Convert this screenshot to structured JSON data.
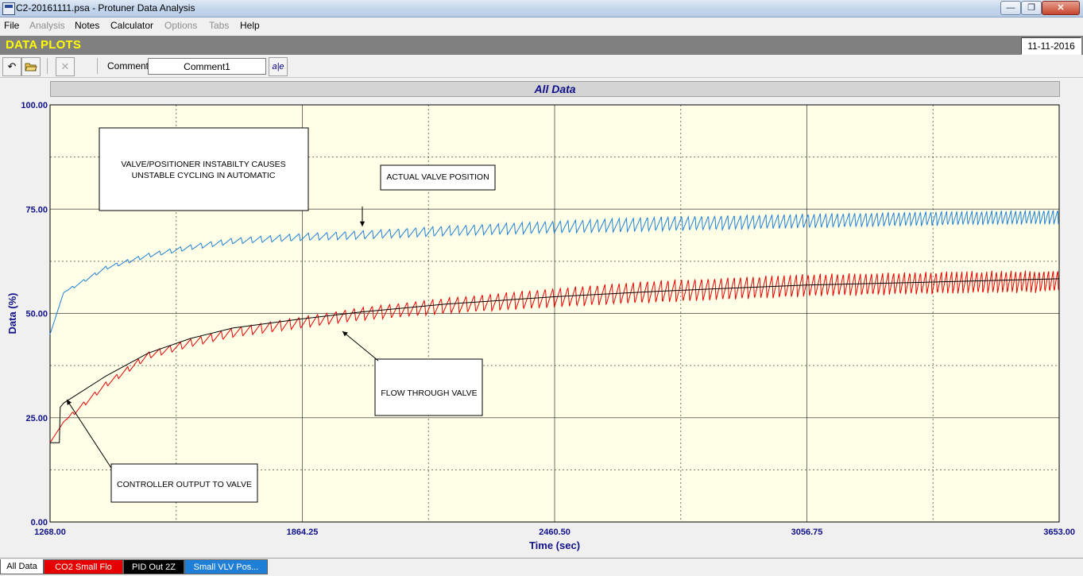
{
  "window": {
    "title": "C2-20161111.psa - Protuner Data  Analysis",
    "controls": {
      "minimize": "—",
      "maximize": "❐",
      "close": "✕"
    }
  },
  "menu": [
    {
      "label": "File",
      "enabled": true
    },
    {
      "label": "Analysis",
      "enabled": false
    },
    {
      "label": "Notes",
      "enabled": true
    },
    {
      "label": "Calculator",
      "enabled": true
    },
    {
      "label": "Options",
      "enabled": false
    },
    {
      "label": "Tabs",
      "enabled": false
    },
    {
      "label": "Help",
      "enabled": true
    }
  ],
  "banner": {
    "title": "DATA PLOTS",
    "date": "11-11-2016"
  },
  "toolbar": {
    "undo_icon": "undo-icon",
    "open_icon": "folder-open-icon",
    "delete_icon": "close-x-icon",
    "comment_label": "Comment",
    "comment_value": "Comment1",
    "font_button_label": "a|e"
  },
  "chart_header": "All Data",
  "chart_data": {
    "type": "line",
    "xlabel": "Time (sec)",
    "ylabel": "Data (%)",
    "xlim": [
      1268,
      3653
    ],
    "ylim": [
      0,
      100
    ],
    "x_ticks": [
      "1268.00",
      "1864.25",
      "2460.50",
      "3056.75",
      "3653.00"
    ],
    "y_ticks": [
      "0.00",
      "25.00",
      "50.00",
      "75.00",
      "100.00"
    ],
    "grid": true,
    "background": "#ffffe8",
    "series": [
      {
        "color": "#1f7fd6",
        "style": "oscillating",
        "start": [
          1268,
          45
        ],
        "x": [
          1268,
          1300,
          1400,
          1500,
          1600,
          1700,
          1864,
          2000,
          2200,
          2460,
          2700,
          3056,
          3300,
          3653
        ],
        "y": [
          45,
          55,
          61,
          64,
          66,
          67.5,
          68.5,
          69,
          70,
          71,
          71.8,
          72.5,
          73,
          73.5
        ],
        "amplitude": 3.5
      },
      {
        "color": "#e60000",
        "style": "oscillating",
        "x": [
          1268,
          1300,
          1400,
          1500,
          1600,
          1700,
          1864,
          2000,
          2200,
          2460,
          2700,
          3056,
          3300,
          3653
        ],
        "y": [
          19,
          24,
          33,
          40,
          43,
          45.5,
          48,
          50,
          52,
          54,
          55.5,
          57,
          57.5,
          58
        ],
        "amplitude": 5.5
      },
      {
        "color": "#000000",
        "style": "smooth",
        "x": [
          1268,
          1290,
          1292,
          1300,
          1400,
          1500,
          1600,
          1700,
          1864,
          2000,
          2200,
          2460,
          2700,
          3056,
          3300,
          3653
        ],
        "y": [
          19,
          19,
          27.5,
          28.5,
          35,
          40.5,
          44,
          46.5,
          48.7,
          50.3,
          52.2,
          54,
          55.3,
          56.8,
          57.4,
          58.3
        ]
      }
    ],
    "annotations": [
      {
        "text_lines": [
          "VALVE/POSITIONER INSTABILTY CAUSES",
          "UNSTABLE CYCLING IN AUTOMATIC"
        ]
      },
      {
        "text_lines": [
          "ACTUAL VALVE POSITION"
        ]
      },
      {
        "text_lines": [
          "FLOW THROUGH VALVE"
        ]
      },
      {
        "text_lines": [
          "CONTROLLER OUTPUT TO VALVE"
        ]
      }
    ]
  },
  "tabs": [
    {
      "label": "All Data",
      "bg": "#ffffff",
      "fg": "#000000",
      "active": true
    },
    {
      "label": "CO2 Small Flo",
      "bg": "#e60000",
      "fg": "#ffffff",
      "active": false
    },
    {
      "label": "PID Out 2Z",
      "bg": "#000000",
      "fg": "#ffffff",
      "active": false
    },
    {
      "label": "Small VLV Pos...",
      "bg": "#1f7fd6",
      "fg": "#ffffff",
      "active": false
    }
  ]
}
